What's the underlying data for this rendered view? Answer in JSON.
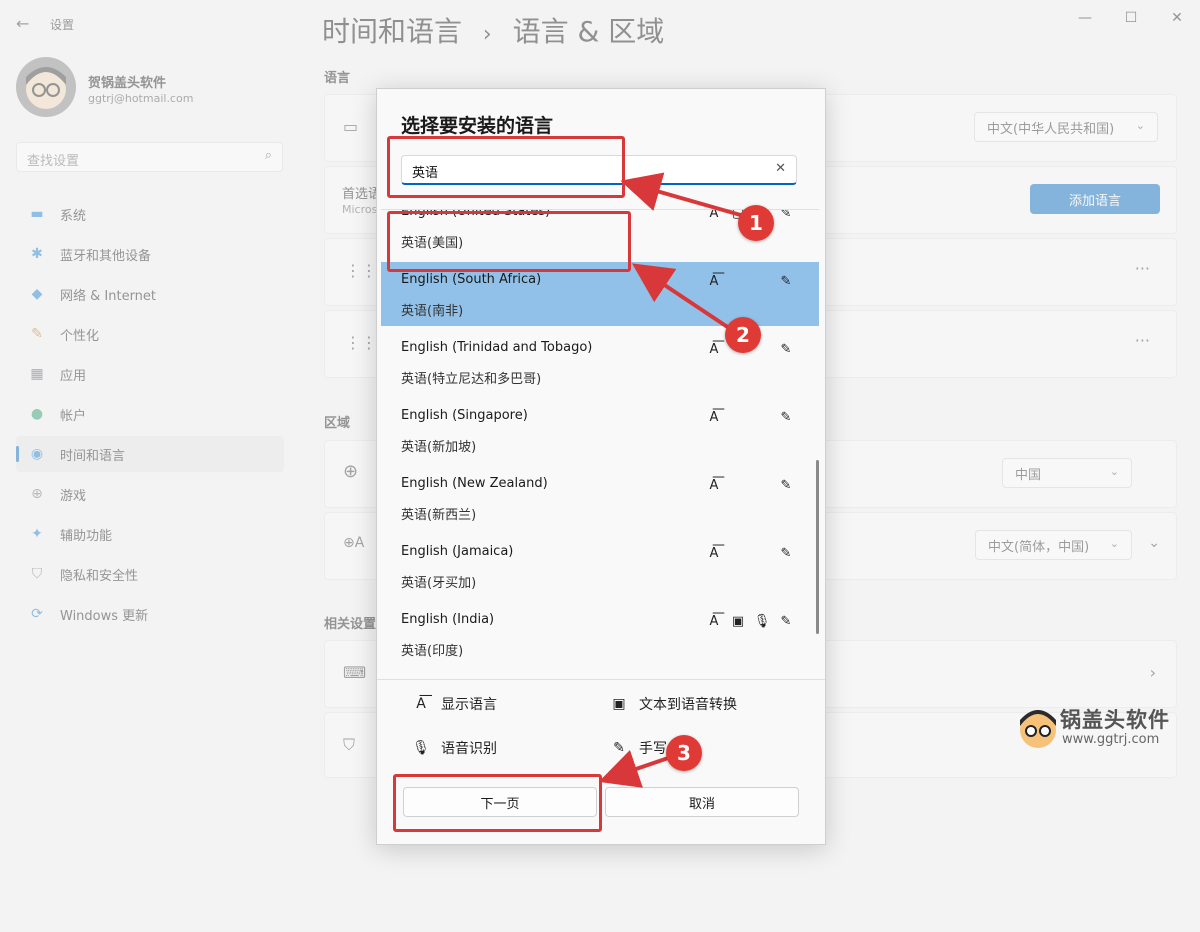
{
  "window": {
    "app_title": "设置",
    "breadcrumb_parent": "时间和语言",
    "breadcrumb_sep": "›",
    "breadcrumb_current": "语言 & 区域"
  },
  "user": {
    "name": "贺锅盖头软件",
    "email": "ggtrj@hotmail.com"
  },
  "sidebar": {
    "search_placeholder": "查找设置",
    "items": [
      {
        "label": "系统",
        "icon": "monitor-icon"
      },
      {
        "label": "蓝牙和其他设备",
        "icon": "bluetooth-icon"
      },
      {
        "label": "网络 & Internet",
        "icon": "wifi-icon"
      },
      {
        "label": "个性化",
        "icon": "brush-icon"
      },
      {
        "label": "应用",
        "icon": "apps-icon"
      },
      {
        "label": "帐户",
        "icon": "person-icon"
      },
      {
        "label": "时间和语言",
        "icon": "globe-clock-icon",
        "active": true
      },
      {
        "label": "游戏",
        "icon": "gamepad-icon"
      },
      {
        "label": "辅助功能",
        "icon": "accessibility-icon"
      },
      {
        "label": "隐私和安全性",
        "icon": "shield-icon"
      },
      {
        "label": "Windows 更新",
        "icon": "update-icon"
      }
    ]
  },
  "main": {
    "language_header": "语言",
    "display_lang_value": "中文(中华人民共和国)",
    "preferred_label": "首选语",
    "preferred_sub": "Micros",
    "add_language_button": "添加语言",
    "region_header": "区域",
    "country_value": "中国",
    "regional_format_value": "中文(简体，中国)",
    "related_header": "相关设置"
  },
  "dialog": {
    "title": "选择要安装的语言",
    "search_value": "英语",
    "languages": [
      {
        "en": "English (United States)",
        "zh": "英语(美国)",
        "features": [
          "display",
          "tts",
          "handwriting"
        ]
      },
      {
        "en": "English (South Africa)",
        "zh": "英语(南非)",
        "features": [
          "display",
          "handwriting"
        ],
        "selected": true
      },
      {
        "en": "English (Trinidad and Tobago)",
        "zh": "英语(特立尼达和多巴哥)",
        "features": [
          "display",
          "handwriting"
        ]
      },
      {
        "en": "English (Singapore)",
        "zh": "英语(新加坡)",
        "features": [
          "display",
          "handwriting"
        ]
      },
      {
        "en": "English (New Zealand)",
        "zh": "英语(新西兰)",
        "features": [
          "display",
          "handwriting"
        ]
      },
      {
        "en": "English (Jamaica)",
        "zh": "英语(牙买加)",
        "features": [
          "display",
          "handwriting"
        ]
      },
      {
        "en": "English (India)",
        "zh": "英语(印度)",
        "features": [
          "display",
          "tts",
          "speech",
          "handwriting"
        ]
      }
    ],
    "legend": {
      "display": "显示语言",
      "tts": "文本到语音转换",
      "speech": "语音识别",
      "handwriting": "手写"
    },
    "next_button": "下一页",
    "cancel_button": "取消"
  },
  "annotations": {
    "badge1": "1",
    "badge2": "2",
    "badge3": "3"
  },
  "watermark": {
    "brand": "锅盖头软件",
    "url": "www.ggtrj.com"
  },
  "colors": {
    "accent": "#0067c0",
    "selected_row": "#91c1e8",
    "annotation_red": "#e03a36"
  }
}
